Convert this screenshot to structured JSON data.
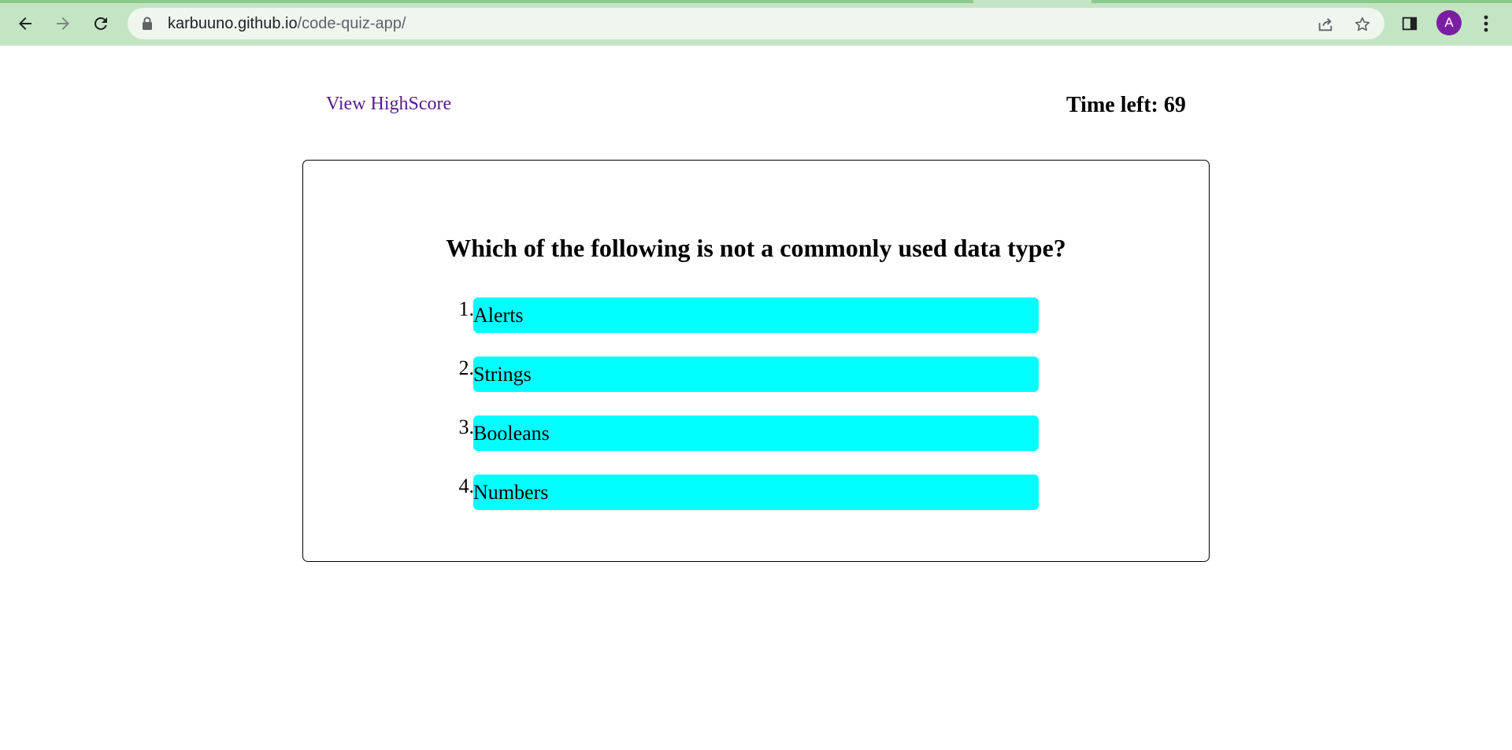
{
  "browser": {
    "url_host": "karbuuno.github.io",
    "url_path": "/code-quiz-app/",
    "avatar_letter": "A",
    "avatar_color": "#7b1fa2",
    "toolbar_color": "#c4e5c4",
    "icons": {
      "back": "back-arrow-icon",
      "forward": "forward-arrow-icon",
      "reload": "reload-icon",
      "lock": "lock-icon",
      "share": "share-icon",
      "bookmark": "star-icon",
      "side_panel": "side-panel-icon",
      "menu": "kebab-menu-icon"
    }
  },
  "header": {
    "highscore_link": "View HighScore",
    "timer_label": "Time left: 69"
  },
  "quiz": {
    "question": "Which of the following is not a commonly used data type?",
    "answers": [
      {
        "number": "1.",
        "label": "Alerts"
      },
      {
        "number": "2.",
        "label": "Strings"
      },
      {
        "number": "3.",
        "label": "Booleans"
      },
      {
        "number": "4.",
        "label": "Numbers"
      }
    ],
    "answer_color": "#00ffff",
    "link_color": "#551a8b"
  }
}
